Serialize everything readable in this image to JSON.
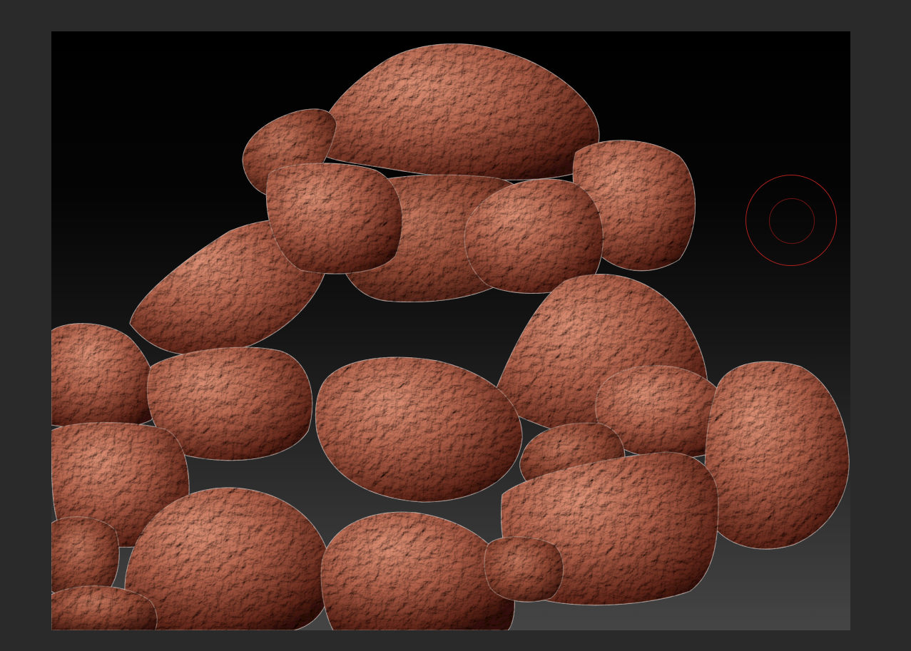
{
  "app": {
    "background_color": "#2a2a2a"
  },
  "viewport": {
    "scene": "rock-pile-sculpt",
    "rock_base_color": "#a8705f",
    "rock_shadow_color": "#3a1a14",
    "rock_highlight_color": "#e2b3a0",
    "rim_light_color": "#d9f2ff",
    "background_top_color": "#000000",
    "background_bottom_color": "#454545"
  },
  "brush_cursor": {
    "icon": "brush-circle-icon",
    "outer_color": "#b0201c",
    "inner_color": "#6e1412"
  }
}
